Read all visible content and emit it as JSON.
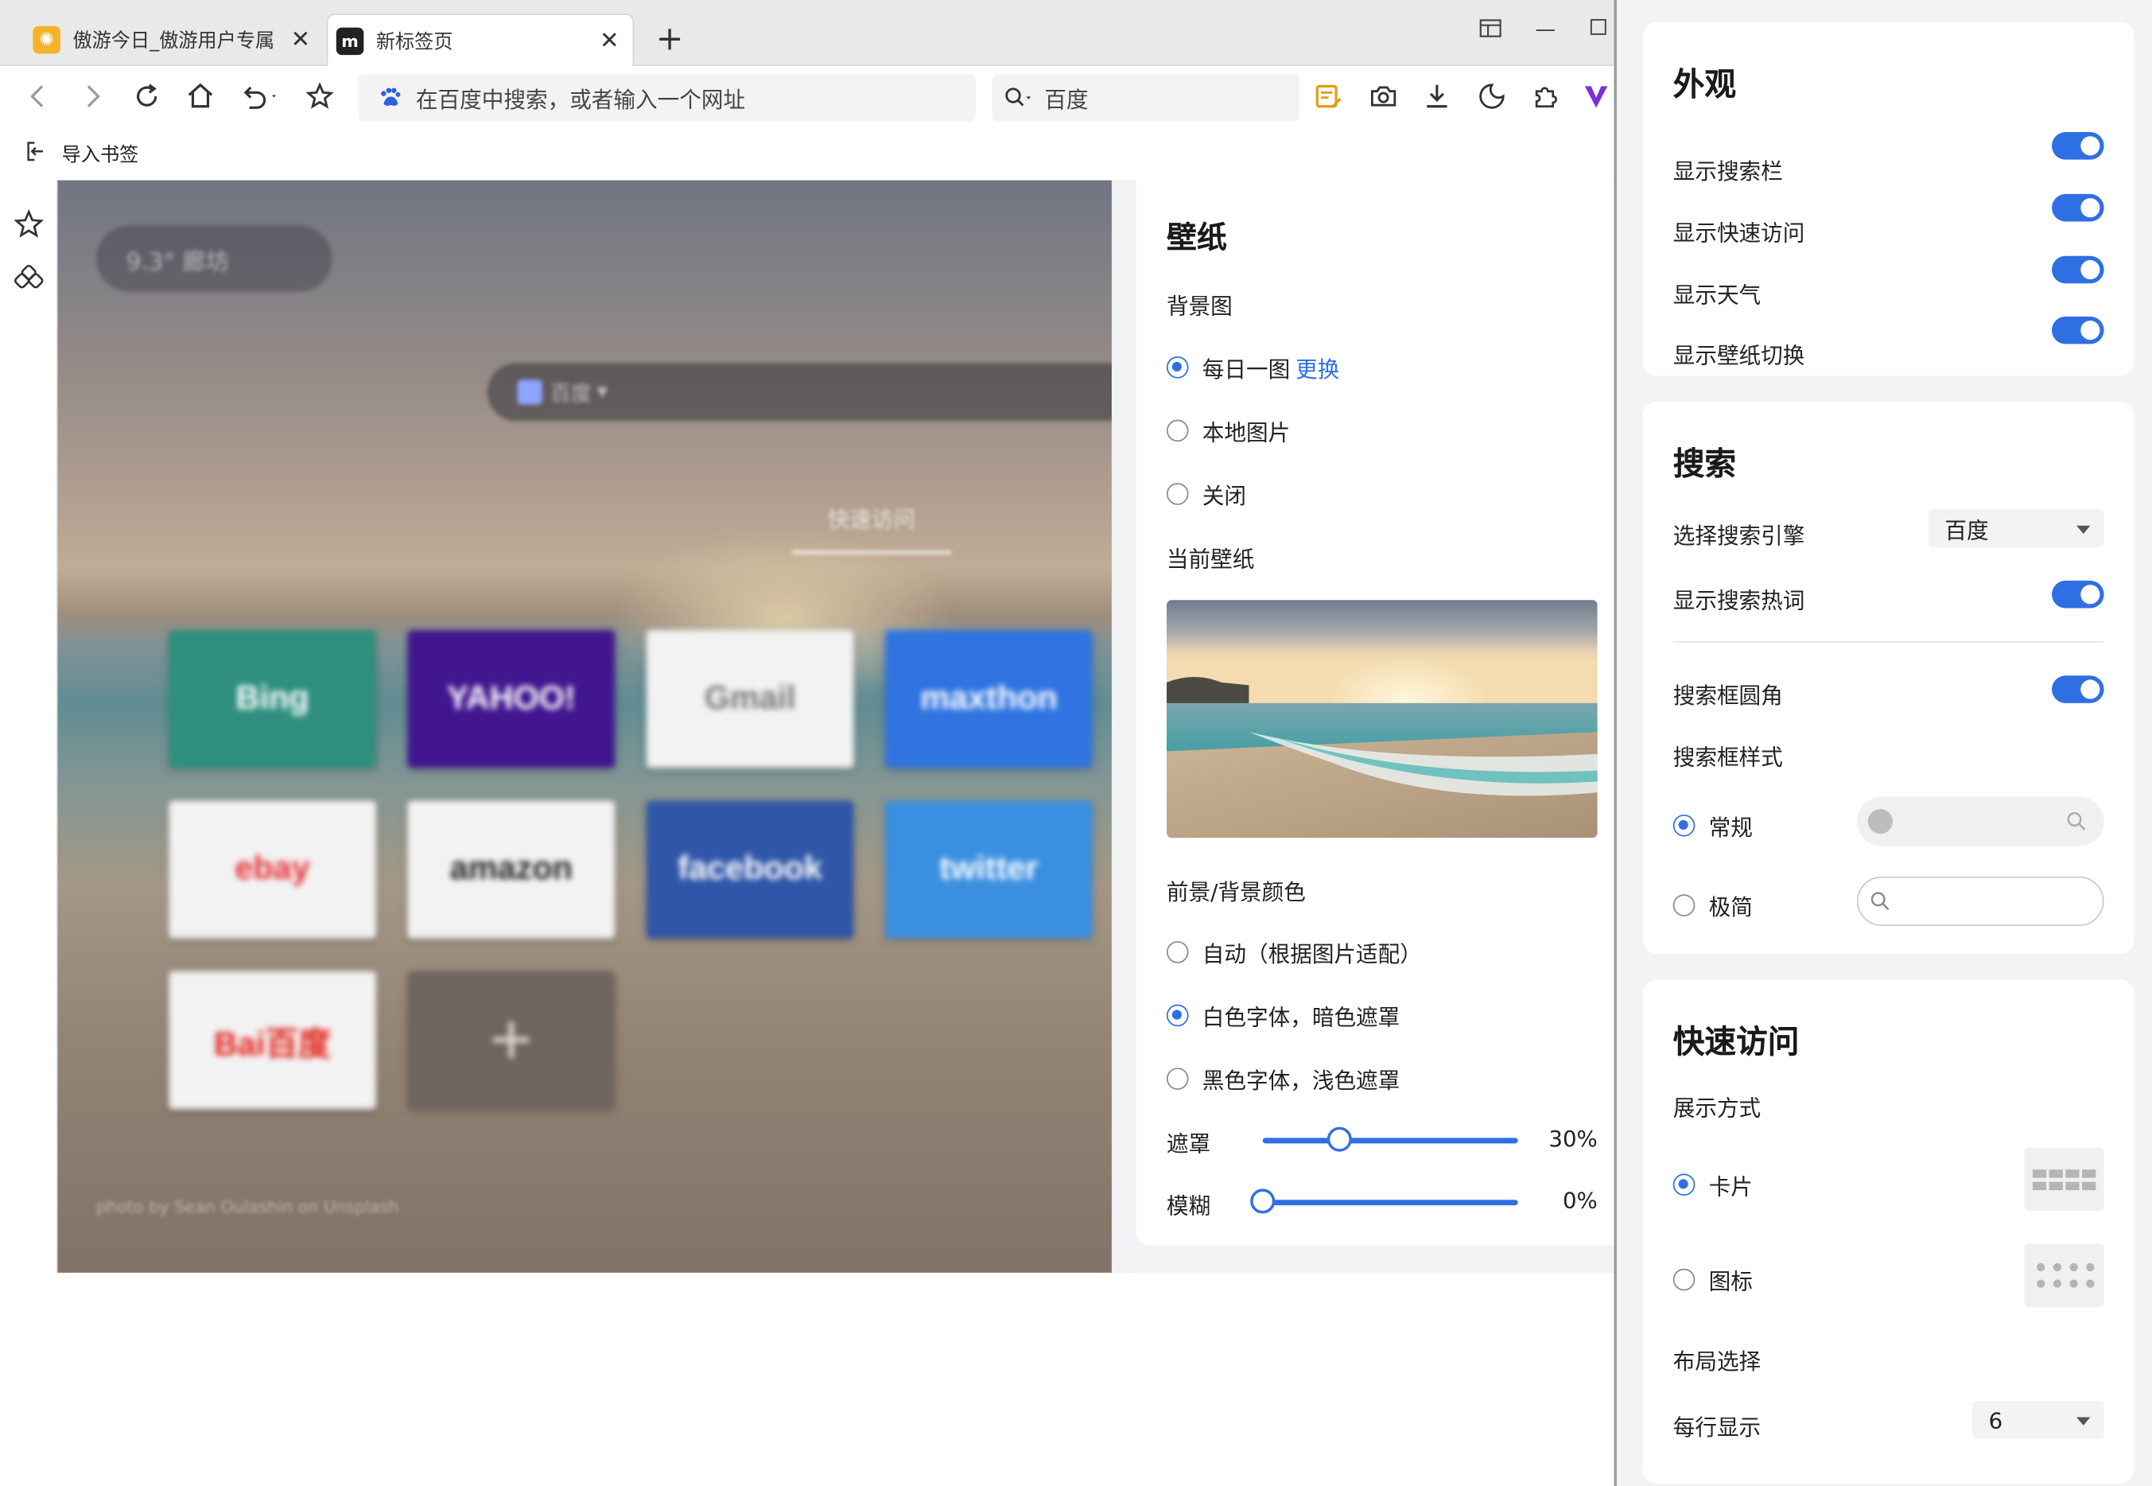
{
  "browser": {
    "tabs": [
      {
        "title": "傲游今日_傲游用户专属",
        "active": false
      },
      {
        "title": "新标签页",
        "active": true
      }
    ],
    "address_placeholder": "在百度中搜索，或者输入一个网址",
    "search_engine_label": "百度",
    "bookmark_import": "导入书签"
  },
  "newtab": {
    "weather": "9.3°  廊坊",
    "search_engine": "百度",
    "quick_access_label": "快速访问",
    "tiles": [
      {
        "label": "Bing",
        "bg": "#2f8f7e",
        "fg": "#ffffff"
      },
      {
        "label": "YAHOO!",
        "bg": "#41168f",
        "fg": "#ffffff"
      },
      {
        "label": "Gmail",
        "bg": "#f2f2f2",
        "fg": "#777777"
      },
      {
        "label": "maxthon",
        "bg": "#2f74e0",
        "fg": "#ffffff"
      },
      {
        "label": "ebay",
        "bg": "#f2f2f2",
        "fg": "#e53238"
      },
      {
        "label": "amazon",
        "bg": "#f2f2f2",
        "fg": "#222222"
      },
      {
        "label": "facebook",
        "bg": "#2f56a8",
        "fg": "#ffffff"
      },
      {
        "label": "twitter",
        "bg": "#3a8fe0",
        "fg": "#ffffff"
      },
      {
        "label": "Bai百度",
        "bg": "#f2f2f2",
        "fg": "#e2231a"
      },
      {
        "label": "+",
        "bg": "#6e6560",
        "fg": "#d9d4cf"
      }
    ],
    "photo_credit": "photo by Sean Oulashin on Unsplash"
  },
  "wallpaper_panel": {
    "title": "壁纸",
    "background_label": "背景图",
    "background_options": [
      {
        "label": "每日一图",
        "selected": true,
        "link": "更换"
      },
      {
        "label": "本地图片",
        "selected": false
      },
      {
        "label": "关闭",
        "selected": false
      }
    ],
    "current_label": "当前壁纸",
    "color_label": "前景/背景颜色",
    "color_options": [
      {
        "label": "自动（根据图片适配）",
        "selected": false
      },
      {
        "label": "白色字体，暗色遮罩",
        "selected": true
      },
      {
        "label": "黑色字体，浅色遮罩",
        "selected": false
      }
    ],
    "mask": {
      "label": "遮罩",
      "value": 30,
      "display": "30%"
    },
    "blur": {
      "label": "模糊",
      "value": 0,
      "display": "0%"
    }
  },
  "settings": {
    "appearance": {
      "title": "外观",
      "toggles": [
        {
          "label": "显示搜索栏",
          "on": true
        },
        {
          "label": "显示快速访问",
          "on": true
        },
        {
          "label": "显示天气",
          "on": true
        },
        {
          "label": "显示壁纸切换",
          "on": true
        }
      ]
    },
    "search": {
      "title": "搜索",
      "engine_label": "选择搜索引擎",
      "engine_value": "百度",
      "hotwords_label": "显示搜索热词",
      "hotwords_on": true,
      "rounded_label": "搜索框圆角",
      "rounded_on": true,
      "style_label": "搜索框样式",
      "style_options": [
        {
          "label": "常规",
          "selected": true
        },
        {
          "label": "极简",
          "selected": false
        }
      ]
    },
    "quick_access": {
      "title": "快速访问",
      "display_label": "展示方式",
      "display_options": [
        {
          "label": "卡片",
          "selected": true
        },
        {
          "label": "图标",
          "selected": false
        }
      ],
      "layout_label": "布局选择",
      "per_row_label": "每行显示",
      "per_row_value": "6"
    }
  },
  "colors": {
    "accent": "#2f6fe4",
    "panel_bg": "#f2f3f5"
  }
}
